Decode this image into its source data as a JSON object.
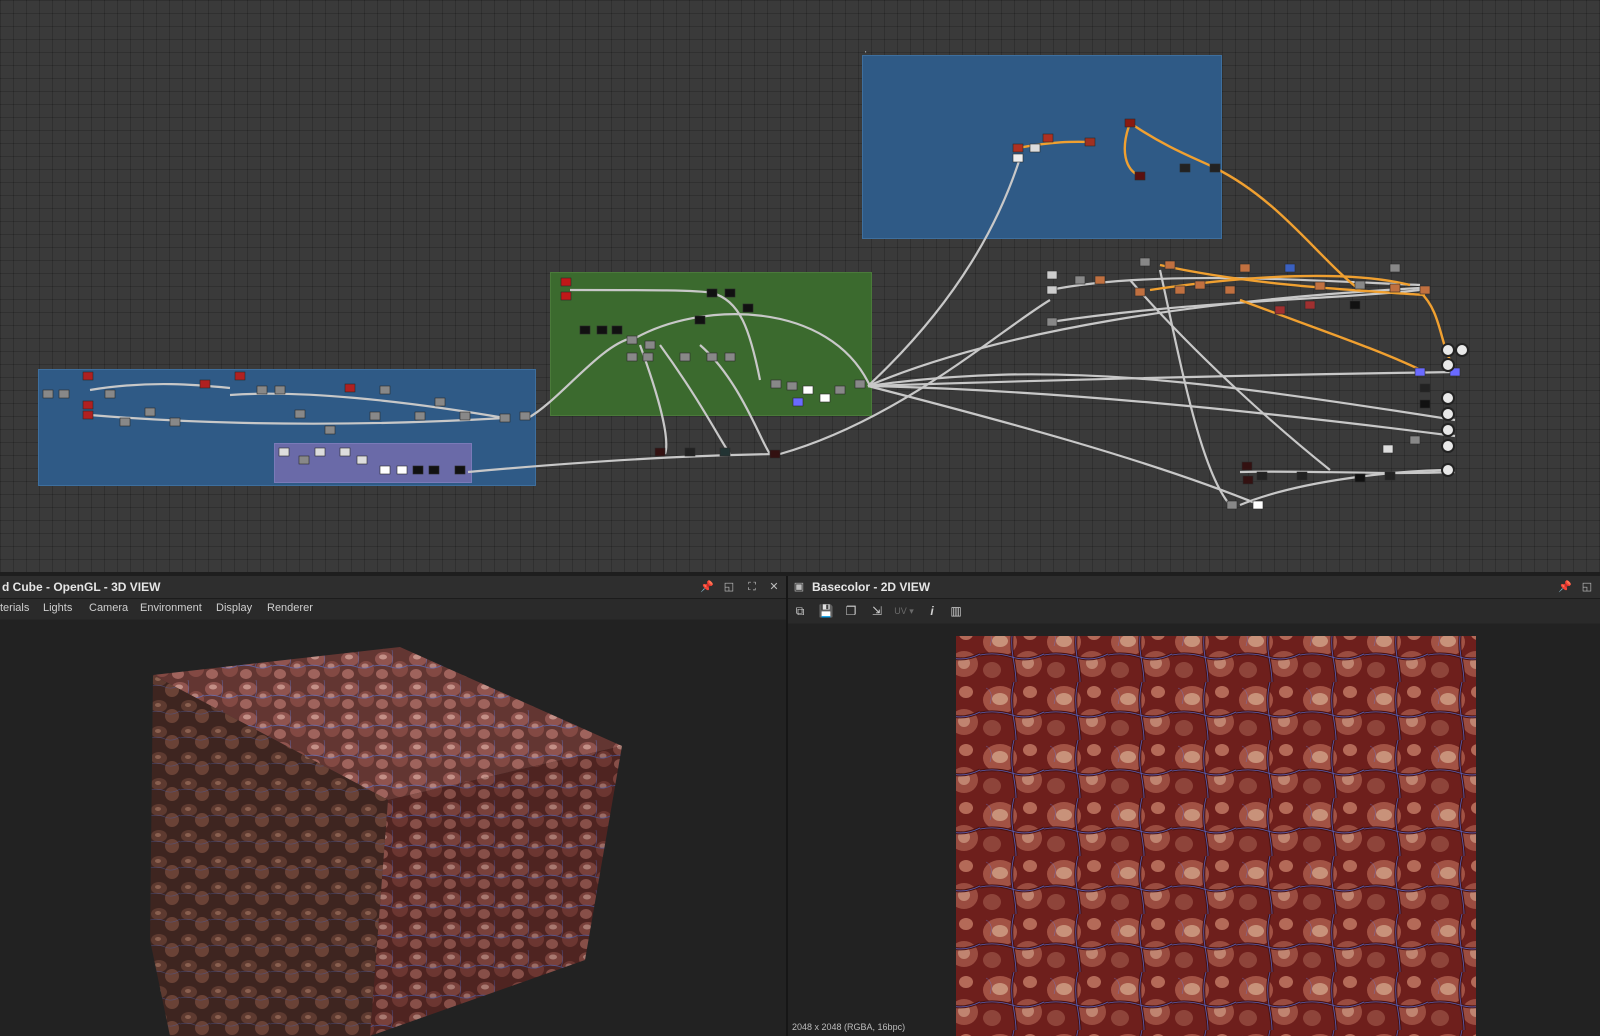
{
  "graph": {
    "frames": [
      {
        "color": "#2f5a86"
      },
      {
        "color": "#3b6a2e"
      },
      {
        "color": "#2f5a86"
      },
      {
        "color": "#6a6aa8"
      }
    ],
    "link_colors": {
      "default": "#c8c8c8",
      "highlight": "#f0a030"
    }
  },
  "viewer3d": {
    "title": "d Cube - OpenGL - 3D VIEW",
    "menu": [
      "terials",
      "Lights",
      "Camera",
      "Environment",
      "Display",
      "Renderer"
    ],
    "icons": [
      "pin-icon",
      "undock-icon",
      "maximize-icon",
      "close-icon"
    ]
  },
  "viewer2d": {
    "title": "Basecolor - 2D VIEW",
    "tools": [
      "screenshot-icon",
      "save-icon",
      "copy-icon",
      "export-icon",
      "uv-dropdown",
      "info-icon",
      "histogram-icon"
    ],
    "uv_label": "UV",
    "status": "2048 x 2048 (RGBA, 16bpc)",
    "icons": [
      "pin-icon",
      "undock-icon"
    ]
  },
  "material": {
    "base": "#7a2a24",
    "vein": "#4a5fc0",
    "cell": "#b06a5a"
  }
}
